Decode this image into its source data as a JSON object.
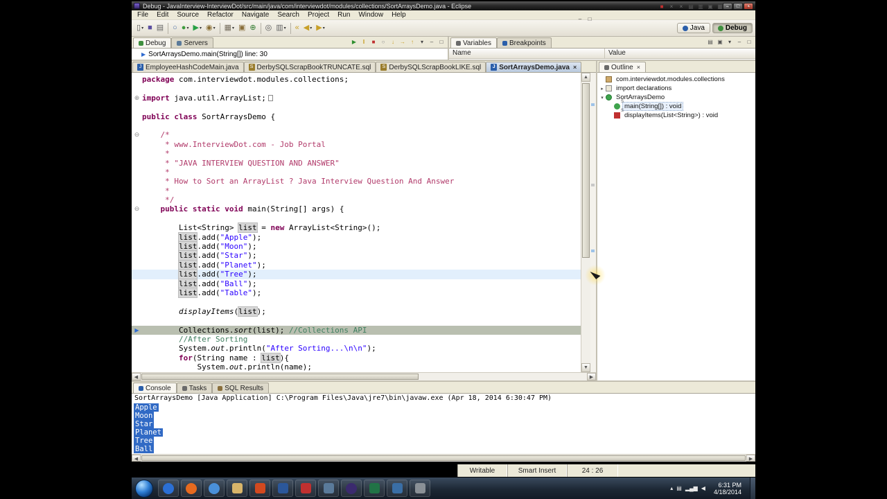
{
  "colors": {
    "keyword": "#7f0055",
    "string": "#2a00ff",
    "block_comment": "#b13a6a",
    "line_comment": "#3f7f5f",
    "occurrence_bg": "#d6d6d6",
    "debug_line_bg": "#b9bfb0",
    "current_line_bg": "#e2effc",
    "selection_bg": "#316ac5"
  },
  "window": {
    "title": "Debug - JavaInterview-InterviewDot/src/main/java/com/interviewdot/modules/collections/SortArraysDemo.java - Eclipse",
    "controls": [
      {
        "name": "minimize-button",
        "glyph": "–"
      },
      {
        "name": "maximize-button",
        "glyph": "□"
      },
      {
        "name": "close-button",
        "glyph": "×"
      }
    ]
  },
  "menubar": {
    "items": [
      "File",
      "Edit",
      "Source",
      "Refactor",
      "Navigate",
      "Search",
      "Project",
      "Run",
      "Window",
      "Help"
    ]
  },
  "toolbar": {
    "items": [
      {
        "name": "new-wizard-icon",
        "glyph": "▯",
        "color": "#555555",
        "dd": true
      },
      {
        "name": "save-icon",
        "glyph": "■",
        "color": "#5b4fa0"
      },
      {
        "name": "print-icon",
        "glyph": "▤",
        "color": "#666666"
      },
      {
        "sep": true
      },
      {
        "name": "skip-breakpoints-icon",
        "glyph": "○",
        "color": "#4a6da8"
      },
      {
        "name": "debug-icon",
        "glyph": "●",
        "color": "#3e9b3e",
        "dd": true
      },
      {
        "name": "run-icon",
        "glyph": "▶",
        "color": "#27a045",
        "dd": true
      },
      {
        "name": "profile-icon",
        "glyph": "◉",
        "color": "#8a6f35",
        "dd": true
      },
      {
        "sep": true
      },
      {
        "name": "new-java-project-icon",
        "glyph": "▦",
        "color": "#776f5f",
        "dd": true
      },
      {
        "name": "new-package-icon",
        "glyph": "▣",
        "color": "#8a6f3c"
      },
      {
        "name": "new-class-icon",
        "glyph": "⊕",
        "color": "#2f7a2f"
      },
      {
        "sep": true
      },
      {
        "name": "search-icon",
        "glyph": "◎",
        "color": "#555555"
      },
      {
        "name": "annotations-icon",
        "glyph": "▥",
        "color": "#666666",
        "dd": true
      },
      {
        "sep": true
      },
      {
        "name": "last-edit-location-icon",
        "glyph": "«",
        "color": "#c8a028"
      },
      {
        "name": "back-icon",
        "glyph": "◀",
        "color": "#c8a028",
        "dd": true
      },
      {
        "name": "forward-icon",
        "glyph": "▶",
        "color": "#c8a028",
        "dd": true
      }
    ],
    "perspectives": {
      "java": "Java",
      "debug": "Debug"
    }
  },
  "debug_pane": {
    "tabs": [
      {
        "label": "Debug",
        "active": true,
        "ic": "#3e8f3e"
      },
      {
        "label": "Servers",
        "active": false,
        "ic": "#5a7a9a"
      }
    ],
    "toolbar": [
      {
        "name": "resume-icon",
        "glyph": "▶",
        "color": "#2f8f2f"
      },
      {
        "name": "suspend-icon",
        "glyph": "‖",
        "color": "#c8a028"
      },
      {
        "name": "terminate-icon",
        "glyph": "■",
        "color": "#c03030"
      },
      {
        "name": "disconnect-icon",
        "glyph": "○",
        "color": "#888888"
      },
      {
        "name": "step-into-icon",
        "glyph": "↓",
        "color": "#c8a028"
      },
      {
        "name": "step-over-icon",
        "glyph": "→",
        "color": "#c8a028"
      },
      {
        "name": "step-return-icon",
        "glyph": "↑",
        "color": "#c8a028"
      },
      {
        "name": "debug-view-menu-icon",
        "glyph": "▾",
        "color": "#444444"
      },
      {
        "name": "debug-minimize-icon",
        "glyph": "–",
        "color": "#444444"
      },
      {
        "name": "debug-maximize-icon",
        "glyph": "□",
        "color": "#444444"
      }
    ],
    "frame": "SortArraysDemo.main(String[]) line: 30"
  },
  "variables_pane": {
    "tabs": [
      {
        "label": "Variables",
        "active": true,
        "ic": "#6a6a6a"
      },
      {
        "label": "Breakpoints",
        "active": false,
        "ic": "#2b5faa"
      }
    ],
    "toolbar": [
      {
        "name": "variables-show-type-icon",
        "glyph": "▤",
        "color": "#555555"
      },
      {
        "name": "variables-collapse-all-icon",
        "glyph": "▣",
        "color": "#555555"
      },
      {
        "name": "variables-view-menu-icon",
        "glyph": "▾",
        "color": "#444444"
      },
      {
        "name": "variables-minimize-icon",
        "glyph": "–",
        "color": "#444444"
      },
      {
        "name": "variables-maximize-icon",
        "glyph": "□",
        "color": "#444444"
      }
    ],
    "columns": [
      "Name",
      "Value"
    ]
  },
  "editor": {
    "tabs": [
      {
        "label": "EmployeeHashCodeMain.java",
        "type": "java",
        "active": false
      },
      {
        "label": "DerbySQLScrapBookTRUNCATE.sql",
        "type": "sql",
        "active": false
      },
      {
        "label": "DerbySQLScrapBookLIKE.sql",
        "type": "sql",
        "active": false
      },
      {
        "label": "SortArraysDemo.java",
        "type": "java",
        "active": true,
        "close": true
      }
    ],
    "corner": [
      {
        "name": "editor-minimize-icon",
        "glyph": "–",
        "color": "#444444"
      },
      {
        "name": "editor-maximize-icon",
        "glyph": "□",
        "color": "#444444"
      }
    ],
    "code": [
      {
        "s": [
          [
            "package",
            "kw"
          ],
          [
            " com.interviewdot.modules.collections;",
            "pl"
          ]
        ]
      },
      {
        "s": []
      },
      {
        "g": "plus",
        "s": [
          [
            "import",
            "kw"
          ],
          [
            " java.util.ArrayList;",
            "pl"
          ],
          [
            "",
            "fb"
          ]
        ]
      },
      {
        "s": []
      },
      {
        "s": [
          [
            "public",
            "kw"
          ],
          [
            " ",
            "pl"
          ],
          [
            "class",
            "kw"
          ],
          [
            " SortArraysDemo {",
            "pl"
          ]
        ]
      },
      {
        "s": []
      },
      {
        "g": "minus",
        "s": [
          [
            "    /*",
            "cb"
          ]
        ]
      },
      {
        "s": [
          [
            "     * www.InterviewDot.com - Job Portal",
            "cb"
          ]
        ]
      },
      {
        "s": [
          [
            "     *",
            "cb"
          ]
        ]
      },
      {
        "s": [
          [
            "     * \"JAVA INTERVIEW QUESTION AND ANSWER\"",
            "cb"
          ]
        ]
      },
      {
        "s": [
          [
            "     *",
            "cb"
          ]
        ]
      },
      {
        "s": [
          [
            "     * How to Sort an ArrayList ? Java Interview Question And Answer",
            "cb"
          ]
        ]
      },
      {
        "s": [
          [
            "     *",
            "cb"
          ]
        ]
      },
      {
        "s": [
          [
            "     */",
            "cb"
          ]
        ]
      },
      {
        "g": "minus",
        "s": [
          [
            "    ",
            "pl"
          ],
          [
            "public",
            "kw"
          ],
          [
            " ",
            "pl"
          ],
          [
            "static",
            "kw"
          ],
          [
            " ",
            "pl"
          ],
          [
            "void",
            "kw"
          ],
          [
            " main(String[] args) {",
            "pl"
          ]
        ]
      },
      {
        "s": []
      },
      {
        "s": [
          [
            "        List<String> ",
            "pl"
          ],
          [
            "list",
            "oc"
          ],
          [
            " = ",
            "pl"
          ],
          [
            "new",
            "kw"
          ],
          [
            " ArrayList<String>();",
            "pl"
          ]
        ]
      },
      {
        "s": [
          [
            "        ",
            "pl"
          ],
          [
            "list",
            "oc"
          ],
          [
            ".add(",
            "pl"
          ],
          [
            "\"Apple\"",
            "str"
          ],
          [
            ");",
            "pl"
          ]
        ]
      },
      {
        "s": [
          [
            "        ",
            "pl"
          ],
          [
            "list",
            "oc"
          ],
          [
            ".add(",
            "pl"
          ],
          [
            "\"Moon\"",
            "str"
          ],
          [
            ");",
            "pl"
          ]
        ]
      },
      {
        "s": [
          [
            "        ",
            "pl"
          ],
          [
            "list",
            "oc"
          ],
          [
            ".add(",
            "pl"
          ],
          [
            "\"Star\"",
            "str"
          ],
          [
            ");",
            "pl"
          ]
        ]
      },
      {
        "s": [
          [
            "        ",
            "pl"
          ],
          [
            "list",
            "oc"
          ],
          [
            ".add(",
            "pl"
          ],
          [
            "\"Planet\"",
            "str"
          ],
          [
            ");",
            "pl"
          ]
        ]
      },
      {
        "h": "line",
        "s": [
          [
            "        ",
            "pl"
          ],
          [
            "list",
            "oc"
          ],
          [
            ".add(",
            "pl"
          ],
          [
            "\"Tree\"",
            "str"
          ],
          [
            ");",
            "pl"
          ]
        ]
      },
      {
        "s": [
          [
            "        ",
            "pl"
          ],
          [
            "list",
            "oc"
          ],
          [
            ".add(",
            "pl"
          ],
          [
            "\"Ball\"",
            "str"
          ],
          [
            ");",
            "pl"
          ]
        ]
      },
      {
        "s": [
          [
            "        ",
            "pl"
          ],
          [
            "list",
            "oc"
          ],
          [
            ".add(",
            "pl"
          ],
          [
            "\"Table\"",
            "str"
          ],
          [
            ");",
            "pl"
          ]
        ]
      },
      {
        "s": []
      },
      {
        "s": [
          [
            "        ",
            "pl"
          ],
          [
            "displayItems",
            "it"
          ],
          [
            "(",
            "pl"
          ],
          [
            "list",
            "oc"
          ],
          [
            ");",
            "pl"
          ]
        ]
      },
      {
        "s": []
      },
      {
        "g": "ip",
        "h": "debug",
        "s": [
          [
            "        Collections.",
            "pl"
          ],
          [
            "sort",
            "it"
          ],
          [
            "(list); ",
            "pl"
          ],
          [
            "//Collections API",
            "cl"
          ]
        ]
      },
      {
        "s": [
          [
            "        //After Sorting",
            "cl"
          ]
        ]
      },
      {
        "s": [
          [
            "        System.",
            "pl"
          ],
          [
            "out",
            "it"
          ],
          [
            ".println(",
            "pl"
          ],
          [
            "\"After Sorting...\\n\\n\"",
            "str"
          ],
          [
            ");",
            "pl"
          ]
        ]
      },
      {
        "s": [
          [
            "        ",
            "pl"
          ],
          [
            "for",
            "kw"
          ],
          [
            "(String name : ",
            "pl"
          ],
          [
            "list",
            "oc"
          ],
          [
            "){",
            "pl"
          ]
        ]
      },
      {
        "s": [
          [
            "            System.",
            "pl"
          ],
          [
            "out",
            "it"
          ],
          [
            ".println(name);",
            "pl"
          ]
        ]
      }
    ]
  },
  "outline": {
    "title": "Outline",
    "toolbar": [
      {
        "name": "outline-sort-icon",
        "glyph": "↓",
        "color": "#555555"
      },
      {
        "name": "outline-hide-fields-icon",
        "glyph": "▫",
        "color": "#555555"
      },
      {
        "name": "outline-hide-static-icon",
        "glyph": "▪",
        "color": "#555555"
      },
      {
        "name": "outline-hide-nonpublic-icon",
        "glyph": "▥",
        "color": "#555555"
      },
      {
        "name": "outline-view-menu-icon",
        "glyph": "▾",
        "color": "#444444"
      },
      {
        "name": "outline-minimize-icon",
        "glyph": "–",
        "color": "#444444"
      },
      {
        "name": "outline-maximize-icon",
        "glyph": "□",
        "color": "#444444"
      }
    ],
    "items": [
      {
        "depth": 0,
        "exp": "none",
        "icon": "package",
        "label": "com.interviewdot.modules.collections"
      },
      {
        "depth": 0,
        "exp": "right",
        "icon": "imports",
        "label": "import declarations"
      },
      {
        "depth": 0,
        "exp": "down",
        "icon": "class",
        "label": "SortArraysDemo"
      },
      {
        "depth": 1,
        "exp": "none",
        "icon": "method-pub",
        "label": "main(String[]) : void",
        "selected": true
      },
      {
        "depth": 1,
        "exp": "none",
        "icon": "method-priv",
        "label": "displayItems(List<String>) : void"
      }
    ]
  },
  "console": {
    "tabs": [
      {
        "label": "Console",
        "active": true,
        "ic": "#2b5faa"
      },
      {
        "label": "Tasks",
        "active": false,
        "ic": "#6a6a6a"
      },
      {
        "label": "SQL Results",
        "active": false,
        "ic": "#8a6f3c"
      }
    ],
    "toolbar": [
      {
        "name": "console-terminate-icon",
        "glyph": "■",
        "color": "#c03030"
      },
      {
        "name": "console-remove-launch-icon",
        "glyph": "×",
        "color": "#777777"
      },
      {
        "name": "console-remove-all-launches-icon",
        "glyph": "×",
        "color": "#777777"
      },
      {
        "name": "console-clear-icon",
        "glyph": "▤",
        "color": "#555555"
      },
      {
        "name": "console-scroll-lock-icon",
        "glyph": "▥",
        "color": "#555555"
      },
      {
        "name": "console-pin-icon",
        "glyph": "▣",
        "color": "#555555"
      },
      {
        "name": "console-open-icon",
        "glyph": "▦",
        "color": "#555555"
      },
      {
        "name": "console-view-menu-icon",
        "glyph": "▾",
        "color": "#444444"
      },
      {
        "name": "console-minimize-icon",
        "glyph": "–",
        "color": "#444444"
      },
      {
        "name": "console-maximize-icon",
        "glyph": "□",
        "color": "#444444"
      }
    ],
    "header": "SortArraysDemo [Java Application] C:\\Program Files\\Java\\jre7\\bin\\javaw.exe (Apr 18, 2014 6:30:47 PM)",
    "output": [
      "Apple",
      "Moon",
      "Star",
      "Planet",
      "Tree",
      "Ball"
    ]
  },
  "statusbar": {
    "writable": "Writable",
    "insert_mode": "Smart Insert",
    "position": "24 : 26"
  },
  "taskbar": {
    "icons": [
      {
        "name": "taskbar-icon-messenger",
        "shape": "circle",
        "color": "#2b6fd4"
      },
      {
        "name": "taskbar-icon-firefox",
        "shape": "circle",
        "color": "#e66a1f"
      },
      {
        "name": "taskbar-icon-chrome",
        "shape": "circle",
        "color": "#4a90d9"
      },
      {
        "name": "taskbar-icon-explorer",
        "shape": "square",
        "color": "#d8b56a"
      },
      {
        "name": "taskbar-icon-powerpoint",
        "shape": "square",
        "color": "#d2491f"
      },
      {
        "name": "taskbar-icon-word",
        "shape": "square",
        "color": "#2b579a"
      },
      {
        "name": "taskbar-icon-media",
        "shape": "square",
        "color": "#c03030"
      },
      {
        "name": "taskbar-icon-tool",
        "shape": "square",
        "color": "#5a7a9a"
      },
      {
        "name": "taskbar-icon-eclipse",
        "shape": "circle",
        "color": "#3b2a6e"
      },
      {
        "name": "taskbar-icon-excel",
        "shape": "square",
        "color": "#217346"
      },
      {
        "name": "taskbar-icon-editor",
        "shape": "square",
        "color": "#3a6ea5"
      },
      {
        "name": "taskbar-icon-app",
        "shape": "square",
        "color": "#8a9096"
      }
    ],
    "tray": [
      {
        "name": "tray-expand-icon",
        "glyph": "▴"
      },
      {
        "name": "tray-status-icon",
        "glyph": "▤"
      },
      {
        "name": "network-icon",
        "glyph": "▂▄▆"
      },
      {
        "name": "volume-icon",
        "glyph": "◀"
      }
    ],
    "clock_time": "6:31 PM",
    "clock_date": "4/18/2014"
  }
}
